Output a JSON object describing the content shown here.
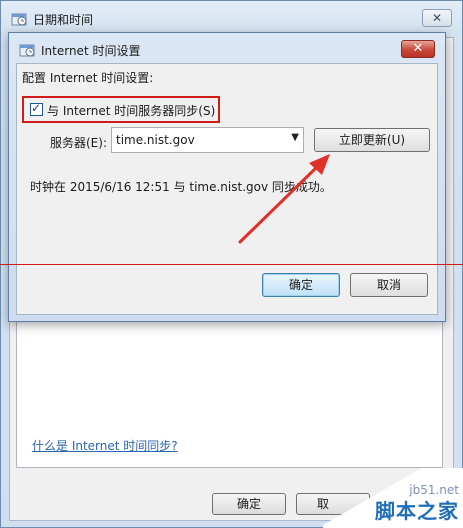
{
  "outer_window": {
    "title": "日期和时间",
    "close_glyph": "✕",
    "help_link": "什么是 Internet 时间同步?",
    "ok_label": "确定",
    "cancel_label_partial": "取"
  },
  "dialog": {
    "title": "Internet 时间设置",
    "close_glyph": "✕",
    "config_label": "配置 Internet 时间设置:",
    "sync_checkbox": {
      "checked": true,
      "label": "与 Internet 时间服务器同步(S)"
    },
    "server": {
      "label": "服务器(E):",
      "value": "time.nist.gov"
    },
    "update_button": "立即更新(U)",
    "status": "时钟在 2015/6/16 12:51 与 time.nist.gov 同步成功。",
    "ok_label": "确定",
    "cancel_label": "取消"
  },
  "watermark": {
    "url": "jb51.net",
    "brand": "脚本之家"
  },
  "icons": {
    "window_icon": "clock-icon",
    "checkbox_mark": "checkmark-icon",
    "dropdown": "chevron-down-icon"
  },
  "colors": {
    "highlight": "#d11a1a",
    "link": "#2b64b0",
    "close_button": "#c9493a"
  }
}
